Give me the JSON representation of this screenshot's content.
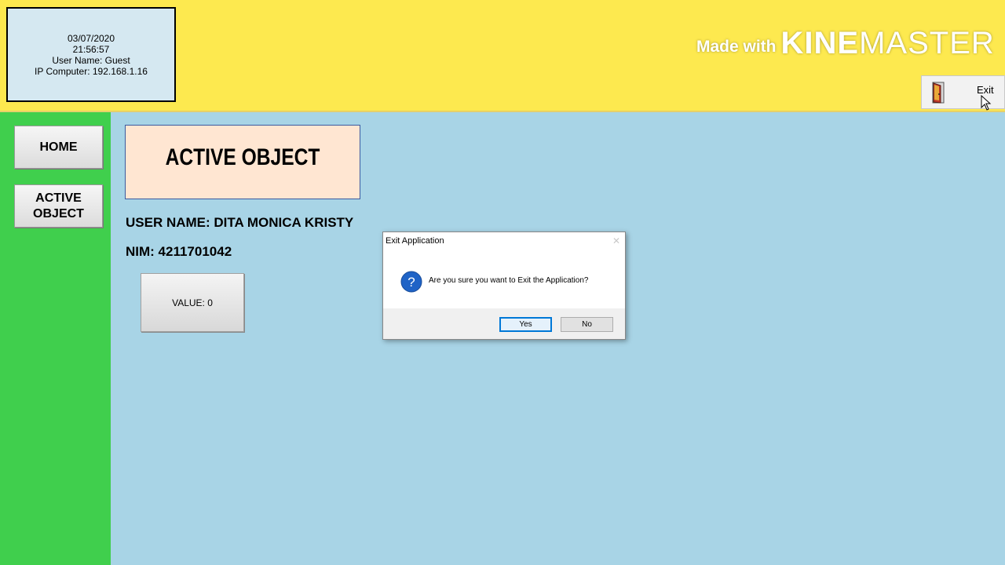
{
  "info_box": {
    "date": "03/07/2020",
    "time": "21:56:57",
    "user_name": "User Name: Guest",
    "ip_computer": "IP Computer: 192.168.1.16"
  },
  "watermark": {
    "made_with": "Made with",
    "kine": "KINE",
    "master": "MASTER"
  },
  "header": {
    "exit_label": "Exit",
    "exit_icon": "door-exit-icon"
  },
  "sidebar": {
    "home_label": "HOME",
    "active_object_line1": "ACTIVE",
    "active_object_line2": "OBJECT"
  },
  "main": {
    "page_title": "ACTIVE OBJECT",
    "user_name": "USER NAME: DITA MONICA KRISTY",
    "nim": "NIM: 4211701042",
    "value_label": "VALUE: 0"
  },
  "dialog": {
    "title": "Exit Application",
    "message": "Are you sure you want to Exit the Application?",
    "yes_label": "Yes",
    "no_label": "No",
    "icon": "question-icon"
  },
  "colors": {
    "header_bg": "#fde94f",
    "sidebar_bg": "#40cf4d",
    "content_bg": "#a8d4e6",
    "title_box_bg": "#ffe6d2",
    "info_box_bg": "#d5e8f1"
  }
}
